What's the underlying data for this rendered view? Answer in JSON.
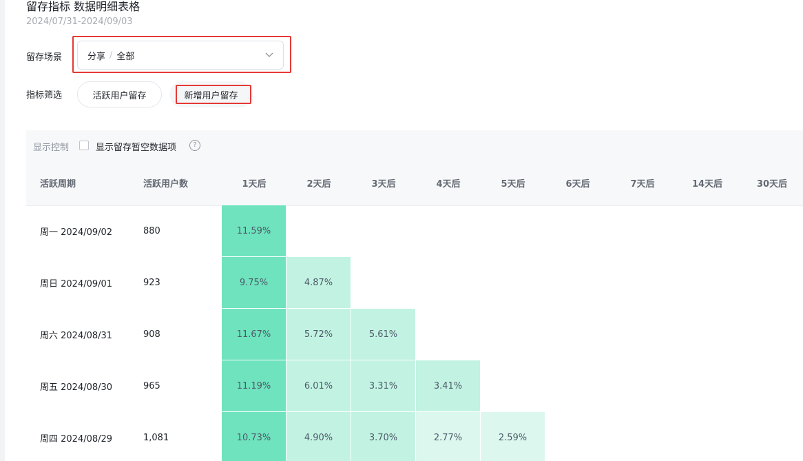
{
  "page": {
    "title": "留存指标 数据明细表格",
    "date_range": "2024/07/31-2024/09/03"
  },
  "filters": {
    "scene_label": "留存场景",
    "scene_path": [
      "分享",
      "全部"
    ],
    "scene_separator": "/",
    "metric_label": "指标筛选",
    "metric_options": [
      "活跃用户留存",
      "新增用户留存"
    ],
    "selected_metric": "新增用户留存"
  },
  "toolbar": {
    "display_label": "显示控制",
    "show_empty_label": "显示留存暂空数据项",
    "show_empty_checked": false,
    "help_glyph": "?"
  },
  "table": {
    "columns": [
      "活跃周期",
      "活跃用户数",
      "1天后",
      "2天后",
      "3天后",
      "4天后",
      "5天后",
      "6天后",
      "7天后",
      "14天后",
      "30天后"
    ],
    "rows": [
      {
        "period": "周一 2024/09/02",
        "users": "880",
        "retention": [
          "11.59%"
        ]
      },
      {
        "period": "周日 2024/09/01",
        "users": "923",
        "retention": [
          "9.75%",
          "4.87%"
        ]
      },
      {
        "period": "周六 2024/08/31",
        "users": "908",
        "retention": [
          "11.67%",
          "5.72%",
          "5.61%"
        ]
      },
      {
        "period": "周五 2024/08/30",
        "users": "965",
        "retention": [
          "11.19%",
          "6.01%",
          "3.31%",
          "3.41%"
        ]
      },
      {
        "period": "周四 2024/08/29",
        "users": "1,081",
        "retention": [
          "10.73%",
          "4.90%",
          "3.70%",
          "2.77%",
          "2.59%"
        ]
      }
    ],
    "heat_colors": {
      "high": "#6ee3bd",
      "mid": "#c2f3e2",
      "low": "#dcf8ee"
    }
  },
  "annotations": {
    "highlight_color": "#e53935"
  }
}
